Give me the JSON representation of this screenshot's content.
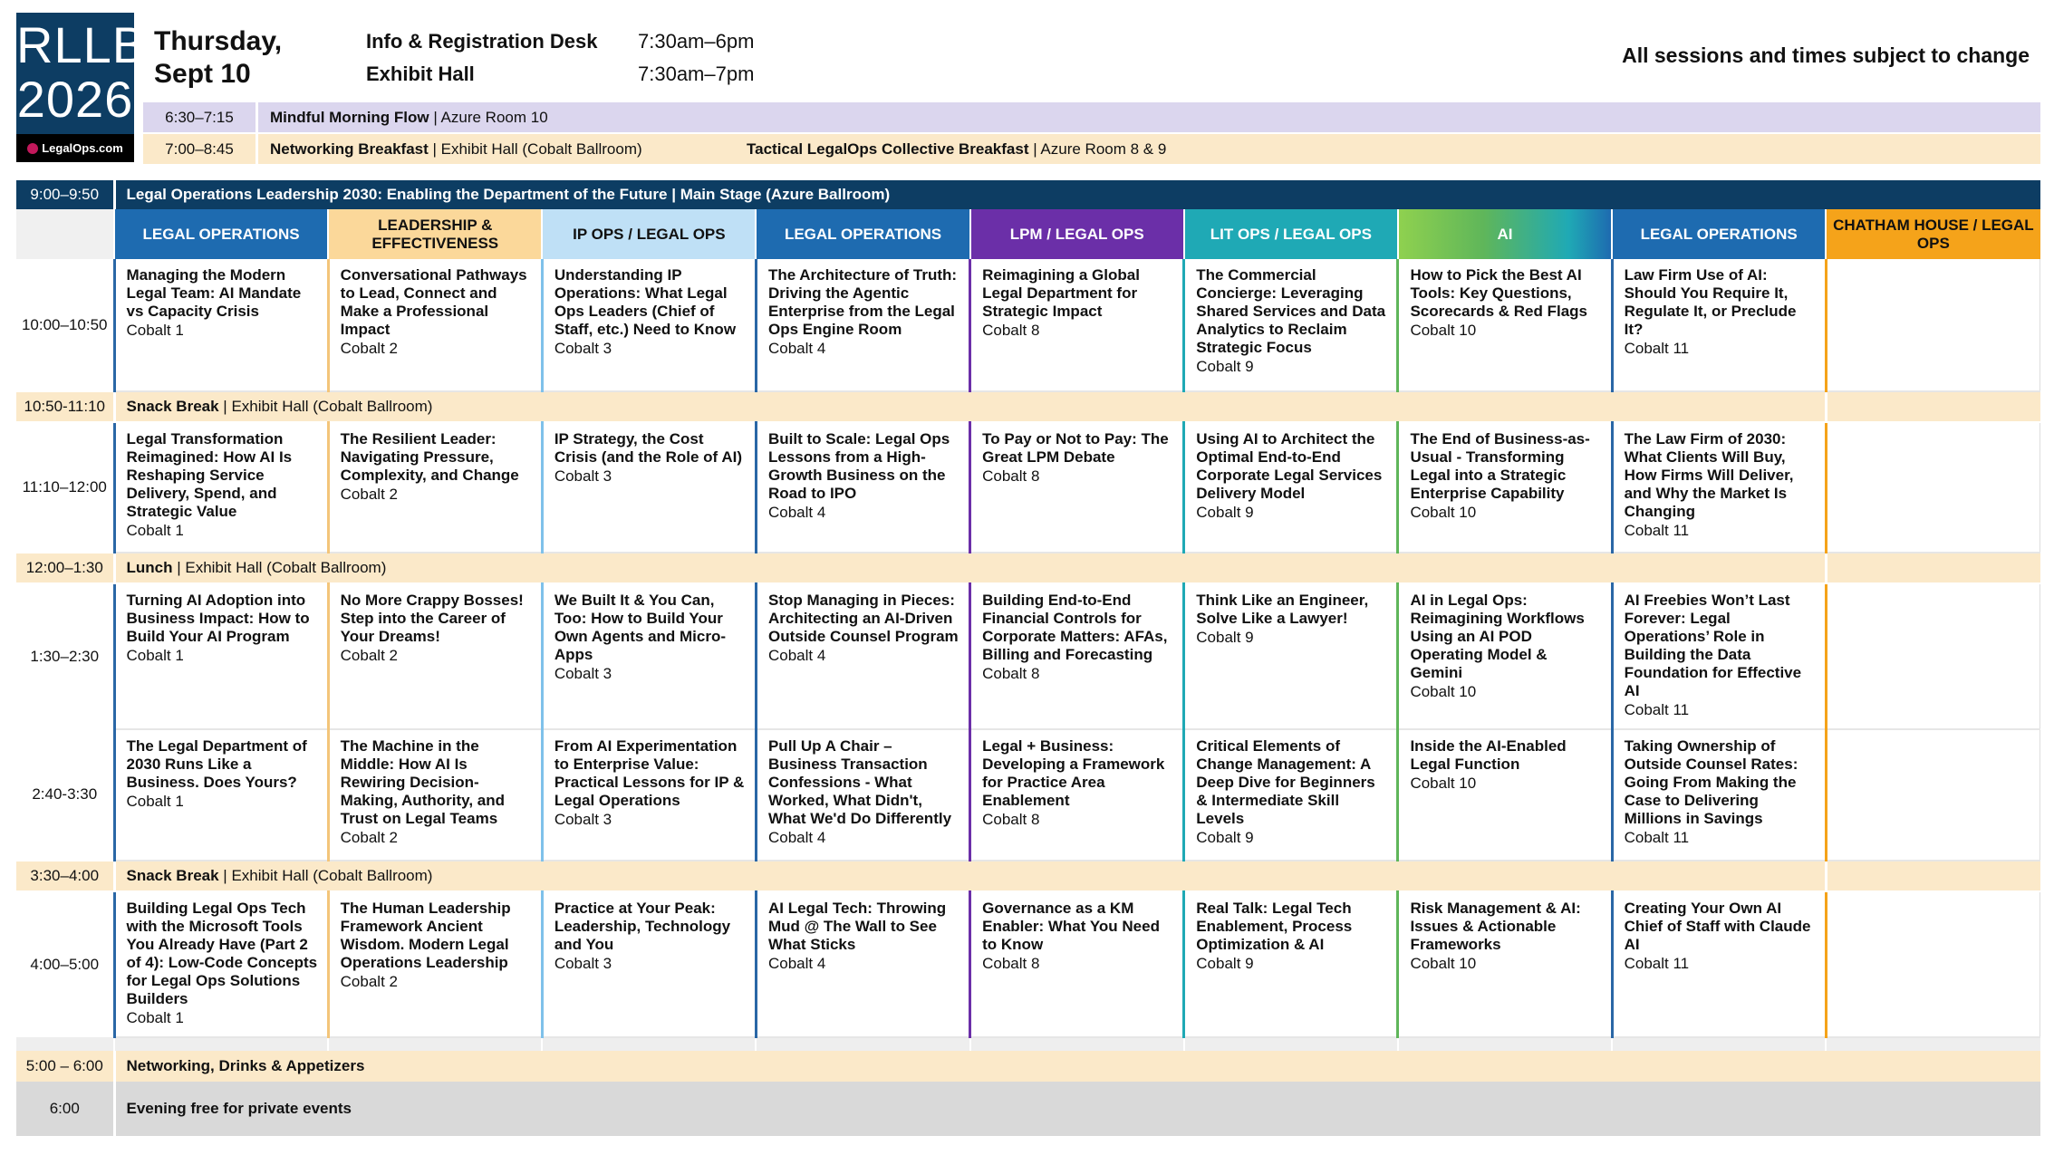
{
  "logo": {
    "line1": "RLLB",
    "line2": "2026",
    "brand": "LegalOps.com"
  },
  "header": {
    "day": "Thursday,",
    "date": "Sept 10",
    "hours": [
      {
        "name": "Info & Registration Desk",
        "time": "7:30am–6pm"
      },
      {
        "name": "Exhibit Hall",
        "time": "7:30am–7pm"
      }
    ],
    "note": "All sessions and times subject to change"
  },
  "morning": [
    {
      "time": "6:30–7:15",
      "title": "Mindful Morning Flow",
      "location": " | Azure Room 10",
      "color": "#dbd6ee"
    },
    {
      "time": "7:00–8:45",
      "title": "Networking Breakfast",
      "location": " | Exhibit Hall (Cobalt Ballroom)",
      "title2": "Tactical LegalOps Collective Breakfast",
      "location2": " | Azure Room 8 & 9",
      "color": "#fbe9c9"
    }
  ],
  "keynote": {
    "time": "9:00–9:50",
    "text": "Legal Operations Leadership 2030: Enabling the Department of the Future | Main Stage (Azure Ballroom)"
  },
  "tracks": [
    {
      "label": "LEGAL OPERATIONS",
      "color": "#1e6bb0",
      "text_color": "#ffffff"
    },
    {
      "label": "LEADERSHIP & EFFECTIVENESS",
      "color": "#fbd89a",
      "text_color": "#111111"
    },
    {
      "label": "IP OPS / LEGAL OPS",
      "color": "#bfe0f6",
      "text_color": "#111111"
    },
    {
      "label": "LEGAL OPERATIONS",
      "color": "#1e6bb0",
      "text_color": "#ffffff"
    },
    {
      "label": "LPM / LEGAL OPS",
      "color": "#6b2fa8",
      "text_color": "#ffffff"
    },
    {
      "label": "LIT OPS / LEGAL OPS",
      "color": "#1fa9b5",
      "text_color": "#ffffff"
    },
    {
      "label": "AI",
      "color": "#5fb65a",
      "text_color": "#ffffff"
    },
    {
      "label": "LEGAL OPERATIONS",
      "color": "#1e6bb0",
      "text_color": "#ffffff"
    },
    {
      "label": "CHATHAM HOUSE / LEGAL OPS",
      "color": "#f5a31a",
      "text_color": "#111111"
    }
  ],
  "track_border_colors": [
    "#2a67a6",
    "#f3c57a",
    "#7fc1ea",
    "#2a67a6",
    "#6b2fa8",
    "#1fa9b5",
    "#5fb65a",
    "#2a67a6",
    "#f5a31a"
  ],
  "schedule": [
    {
      "type": "session",
      "time": "10:00–10:50",
      "height": 145,
      "sessions": [
        {
          "title": "Managing the Modern Legal Team: AI Mandate vs Capacity Crisis",
          "room": "Cobalt 1"
        },
        {
          "title": "Conversational Pathways to Lead, Connect and Make a Professional Impact",
          "room": "Cobalt 2"
        },
        {
          "title": "Understanding IP Operations: What Legal Ops Leaders (Chief of Staff, etc.) Need to Know",
          "room": "Cobalt 3"
        },
        {
          "title": "The Architecture of Truth: Driving the Agentic Enterprise from the Legal Ops Engine Room",
          "room": "Cobalt 4"
        },
        {
          "title": "Reimagining a Global Legal Department for Strategic Impact",
          "room": "Cobalt 8"
        },
        {
          "title": "The Commercial Concierge: Leveraging Shared Services and Data Analytics to Reclaim Strategic Focus",
          "room": "Cobalt 9"
        },
        {
          "title": "How to Pick the Best AI Tools: Key Questions, Scorecards & Red Flags",
          "room": "Cobalt 10"
        },
        {
          "title": "Law Firm Use of AI: Should You Require It, Regulate It, or Preclude It?",
          "room": "Cobalt 11"
        },
        {
          "title": "",
          "room": ""
        }
      ]
    },
    {
      "type": "break",
      "time": "10:50-11:10",
      "title": "Snack Break",
      "location": " | Exhibit Hall (Cobalt Ballroom)"
    },
    {
      "type": "session",
      "time": "11:10–12:00",
      "height": 142,
      "sessions": [
        {
          "title": "Legal Transformation Reimagined: How AI Is Reshaping Service Delivery, Spend, and Strategic Value",
          "room": "Cobalt 1"
        },
        {
          "title": "The Resilient Leader: Navigating Pressure, Complexity, and Change",
          "room": "Cobalt 2"
        },
        {
          "title": "IP Strategy, the Cost Crisis (and the Role of AI)",
          "room": "Cobalt 3"
        },
        {
          "title": "Built to Scale: Legal Ops Lessons from a High-Growth Business on the Road to IPO",
          "room": "Cobalt 4"
        },
        {
          "title": "To Pay or Not to Pay: The Great LPM Debate",
          "room": "Cobalt 8"
        },
        {
          "title": "Using AI to Architect the Optimal End-to-End Corporate Legal Services Delivery Model",
          "room": "Cobalt 9"
        },
        {
          "title": "The End of Business-as-Usual - Transforming Legal into a Strategic Enterprise Capability",
          "room": "Cobalt 10"
        },
        {
          "title": "The Law Firm of 2030: What Clients Will Buy, How Firms Will Deliver, and Why the Market Is Changing",
          "room": "Cobalt 11"
        },
        {
          "title": "",
          "room": ""
        }
      ]
    },
    {
      "type": "break",
      "time": "12:00–1:30",
      "title": "Lunch",
      "location": " | Exhibit Hall (Cobalt Ballroom)"
    },
    {
      "type": "session",
      "time": "1:30–2:30",
      "height": 160,
      "sessions": [
        {
          "title": "Turning AI Adoption into Business Impact: How to Build Your AI Program",
          "room": "Cobalt 1"
        },
        {
          "title": "No More Crappy Bosses! Step into the Career of Your Dreams!",
          "room": "Cobalt 2"
        },
        {
          "title": "We Built It & You Can, Too: How to Build Your Own Agents and Micro-Apps",
          "room": "Cobalt 3"
        },
        {
          "title": "Stop Managing in Pieces: Architecting an AI-Driven Outside Counsel Program",
          "room": "Cobalt 4"
        },
        {
          "title": "Building End-to-End Financial Controls for Corporate Matters: AFAs, Billing and Forecasting",
          "room": "Cobalt 8"
        },
        {
          "title": "Think Like an Engineer, Solve Like a Lawyer!",
          "room": "Cobalt 9"
        },
        {
          "title": "AI in Legal Ops: Reimagining Workflows Using an AI POD Operating Model & Gemini",
          "room": "Cobalt 10"
        },
        {
          "title": "AI Freebies Won’t Last Forever: Legal Operations’ Role in Building the Data Foundation for Effective AI",
          "room": "Cobalt 11"
        },
        {
          "title": "",
          "room": ""
        }
      ]
    },
    {
      "type": "session",
      "time": "2:40-3:30",
      "height": 144,
      "sessions": [
        {
          "title": "The Legal Department of 2030 Runs Like a Business. Does Yours?",
          "room": "Cobalt 1"
        },
        {
          "title": "The Machine in the Middle: How AI Is Rewiring Decision-Making, Authority, and Trust on Legal Teams",
          "room": "Cobalt 2"
        },
        {
          "title": "From AI Experimentation to Enterprise Value: Practical Lessons for IP & Legal Operations",
          "room": "Cobalt 3"
        },
        {
          "title": "Pull Up A Chair – Business Transaction Confessions - What Worked, What Didn't, What We'd Do Differently",
          "room": "Cobalt 4"
        },
        {
          "title": "Legal + Business: Developing a Framework for Practice Area Enablement",
          "room": "Cobalt 8"
        },
        {
          "title": "Critical Elements of Change Management: A Deep Dive for Beginners & Intermediate Skill Levels",
          "room": "Cobalt 9"
        },
        {
          "title": "Inside the AI-Enabled Legal Function",
          "room": "Cobalt 10"
        },
        {
          "title": "Taking Ownership of Outside Counsel Rates: Going From Making the Case to Delivering Millions in Savings",
          "room": "Cobalt 11"
        },
        {
          "title": "",
          "room": ""
        }
      ]
    },
    {
      "type": "break",
      "time": "3:30–4:00",
      "title": "Snack Break",
      "location": " | Exhibit Hall (Cobalt Ballroom)"
    },
    {
      "type": "session",
      "time": "4:00–5:00",
      "height": 160,
      "sessions": [
        {
          "title": "Building Legal Ops Tech with the Microsoft Tools You Already Have (Part 2 of 4): Low-Code Concepts for Legal Ops Solutions Builders",
          "room": "Cobalt 1"
        },
        {
          "title": "The Human Leadership Framework Ancient Wisdom. Modern Legal Operations Leadership",
          "room": "Cobalt 2"
        },
        {
          "title": "Practice at Your Peak: Leadership, Technology and You",
          "room": "Cobalt 3"
        },
        {
          "title": "AI Legal Tech: Throwing Mud @ The Wall to See What Sticks",
          "room": "Cobalt 4"
        },
        {
          "title": "Governance as a KM Enabler: What You Need to Know",
          "room": "Cobalt 8"
        },
        {
          "title": "Real Talk: Legal Tech Enablement, Process Optimization & AI",
          "room": "Cobalt 9"
        },
        {
          "title": "Risk Management & AI: Issues & Actionable Frameworks",
          "room": "Cobalt 10"
        },
        {
          "title": "Creating Your Own AI Chief of Staff with Claude AI",
          "room": "Cobalt 11"
        },
        {
          "title": "",
          "room": ""
        }
      ]
    },
    {
      "type": "spacer"
    },
    {
      "type": "networking",
      "time": "5:00 – 6:00",
      "title": "Networking, Drinks & Appetizers"
    },
    {
      "type": "evening",
      "time": "6:00",
      "title": "Evening free for private events"
    }
  ]
}
